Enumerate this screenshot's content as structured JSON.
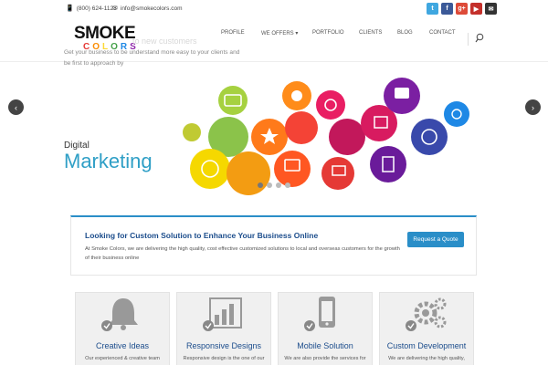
{
  "topbar": {
    "phone": "(800) 624-1123",
    "email": "info@smokecolors.com",
    "social": [
      {
        "name": "twitter",
        "label": "t",
        "color": "#3fa7e0"
      },
      {
        "name": "facebook",
        "label": "f",
        "color": "#3b5998"
      },
      {
        "name": "google-plus",
        "label": "g+",
        "color": "#dd4b39"
      },
      {
        "name": "youtube",
        "label": "▶",
        "color": "#c4302b"
      },
      {
        "name": "email",
        "label": "✉",
        "color": "#333333"
      }
    ]
  },
  "logo": {
    "line1": "SMOKE",
    "line2": "COLORS"
  },
  "nav": {
    "items": [
      "PROFILE",
      "WE OFFERS",
      "PORTFOLIO",
      "CLIENTS",
      "BLOG",
      "CONTACT"
    ],
    "dropdown_caret": "▾"
  },
  "slider": {
    "ghost_text": "to new customers",
    "tagline": "Get your business to be understand more easy to your clients and be first to approach by",
    "digital": "Digital",
    "marketing": "Marketing",
    "prev": "‹",
    "next": "›",
    "dot_count": 4,
    "active_dot": 1
  },
  "cta": {
    "heading": "Looking for Custom Solution to Enhance Your Business Online",
    "body": "At Smoke Colors, we are delivering the high quality, cost effective customized solutions to local and overseas customers for the growth of their business online",
    "button": "Request a Quote"
  },
  "features": [
    {
      "title": "Creative Ideas",
      "desc": "Our experienced & creative team",
      "icon": "bell-icon"
    },
    {
      "title": "Responsive Designs",
      "desc": "Responsive design is the one of our",
      "icon": "bar-chart-icon"
    },
    {
      "title": "Mobile Solution",
      "desc": "We are also provide the services for",
      "icon": "mobile-icon"
    },
    {
      "title": "Custom Development",
      "desc": "We are delivering the high quality,",
      "icon": "gears-icon"
    }
  ],
  "colors": {
    "accent": "#2a8ec8",
    "heading_blue": "#1c4d8c",
    "marketing": "#2f9fc6"
  }
}
